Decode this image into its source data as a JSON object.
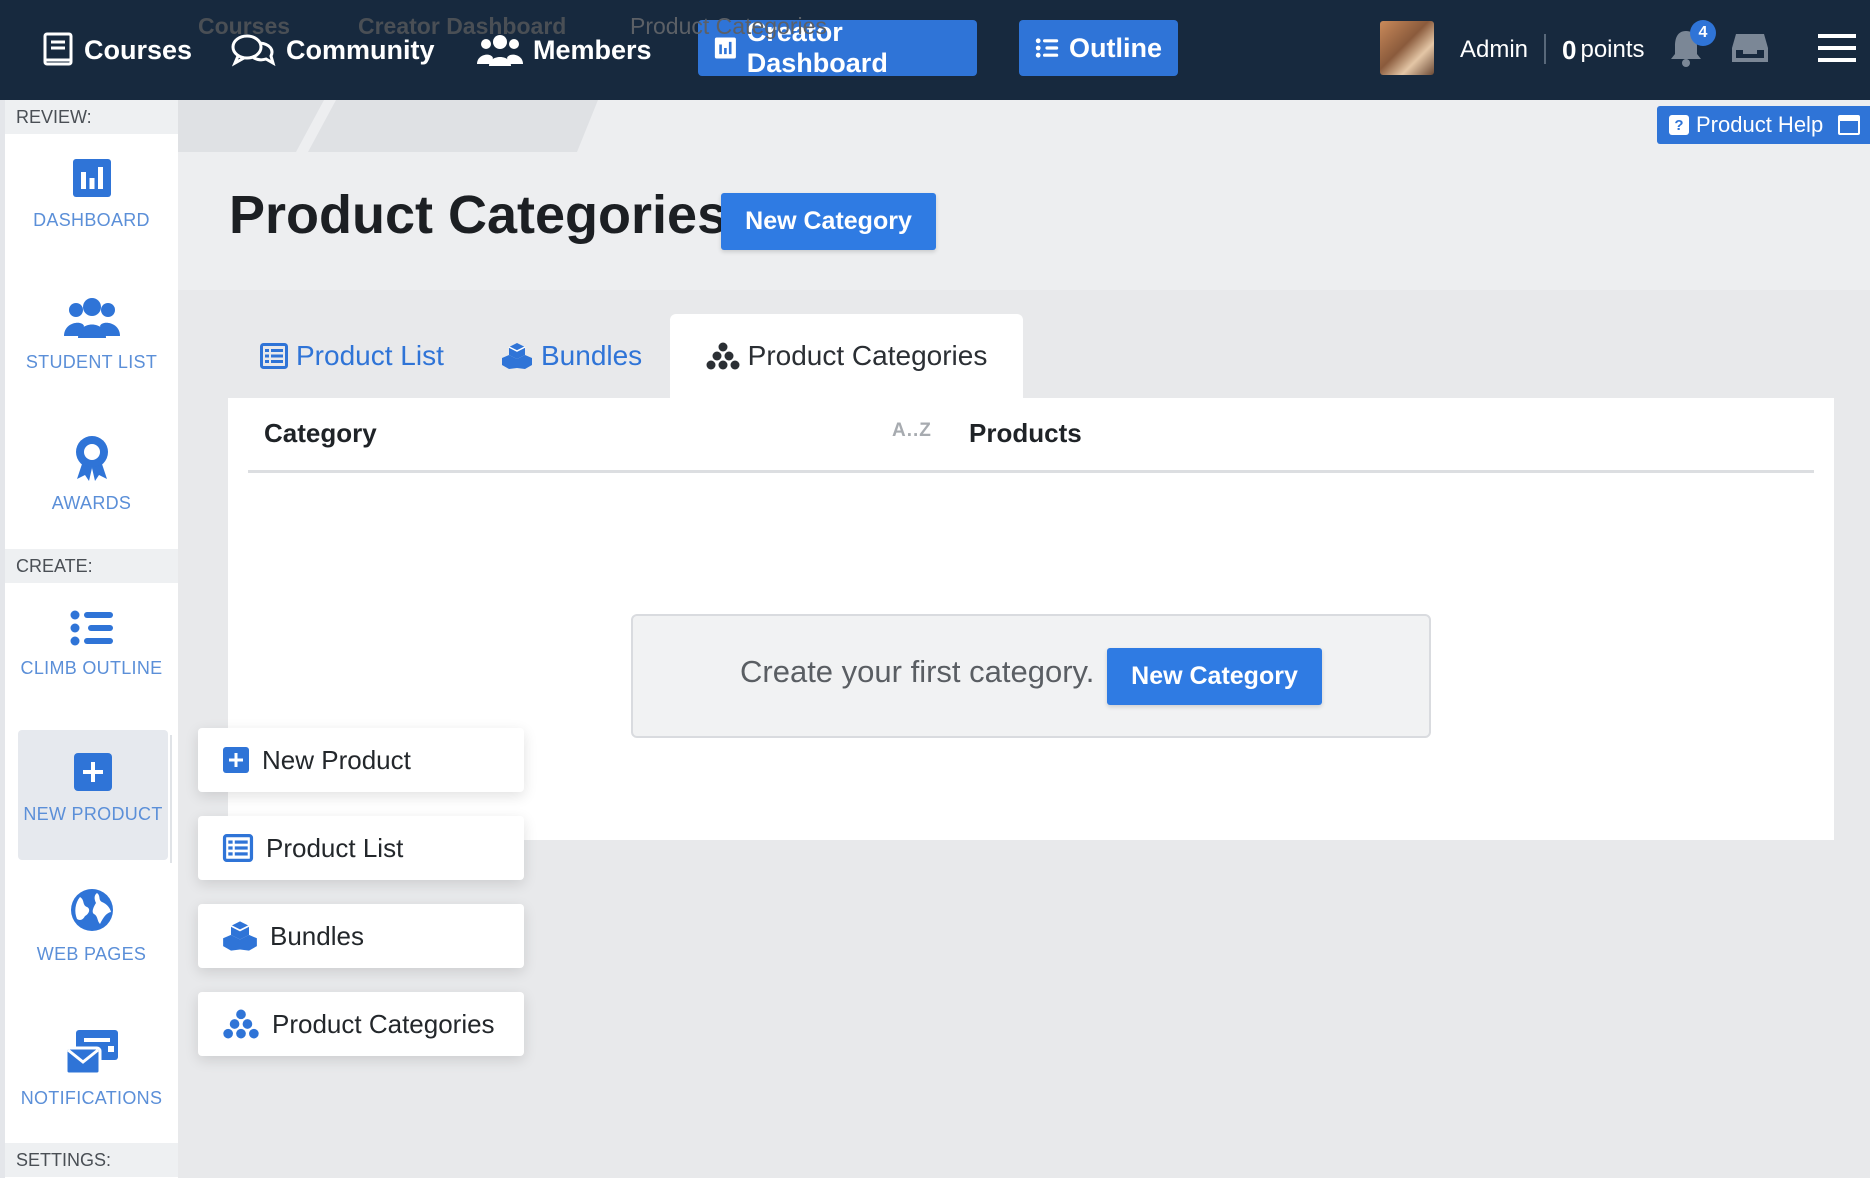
{
  "topnav": {
    "courses": "Courses",
    "community": "Community",
    "members": "Members",
    "creator_dashboard": "Creator Dashboard",
    "outline": "Outline",
    "user": "Admin",
    "points_value": "0",
    "points_label": "points",
    "notification_count": "4"
  },
  "sidebar": {
    "review_label": "REVIEW:",
    "create_label": "CREATE:",
    "settings_label": "SETTINGS:",
    "items": [
      {
        "label": "DASHBOARD"
      },
      {
        "label": "STUDENT LIST"
      },
      {
        "label": "AWARDS"
      },
      {
        "label": "CLIMB OUTLINE"
      },
      {
        "label": "NEW PRODUCT"
      },
      {
        "label": "WEB PAGES"
      },
      {
        "label": "NOTIFICATIONS"
      }
    ]
  },
  "breadcrumb": {
    "items": [
      "Courses",
      "Creator Dashboard",
      "Product Categories"
    ]
  },
  "help": {
    "label": "Product Help"
  },
  "page": {
    "title": "Product Categories",
    "new_category": "New Category"
  },
  "tabs": [
    {
      "label": "Product List"
    },
    {
      "label": "Bundles"
    },
    {
      "label": "Product Categories"
    }
  ],
  "table": {
    "col_category": "Category",
    "sort_hint": "A..Z",
    "col_products": "Products"
  },
  "empty": {
    "message": "Create your first category.",
    "button": "New Category"
  },
  "submenu": [
    {
      "label": "New Product"
    },
    {
      "label": "Product List"
    },
    {
      "label": "Bundles"
    },
    {
      "label": "Product Categories"
    }
  ],
  "colors": {
    "nav_bg": "#17293e",
    "accent": "#2f74d7",
    "page_bg": "#edeef0"
  }
}
